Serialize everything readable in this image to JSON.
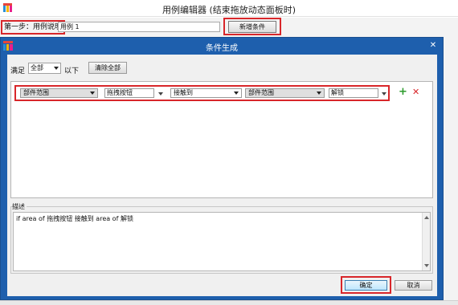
{
  "window": {
    "title": "用例编辑器 (结束拖放动态面板时)",
    "step_label": "第一步：用例说明",
    "case_name": "用例 1",
    "new_condition_label": "新增条件",
    "logo_colors": [
      "#e8453c",
      "#2b8fd6",
      "#f5b400",
      "#e91e8c"
    ]
  },
  "dialog": {
    "title": "条件生成",
    "close_glyph": "✕",
    "title_bar_color": "#1e5fad",
    "match_prefix": "满足",
    "match_value": "全部",
    "match_suffix": "以下",
    "clear_all_label": "清除全部",
    "condition": {
      "field1": "部件范围",
      "value1": "拖拽按钮",
      "operator": "接触到",
      "field2": "部件范围",
      "value2": "解锁",
      "add_icon": "+",
      "delete_icon": "✕"
    },
    "description_label": "描述",
    "description_text": "if area of 拖拽按钮 接触到 area of 解锁",
    "ok_label": "确定",
    "cancel_label": "取消",
    "highlight_color": "#d8262a"
  }
}
